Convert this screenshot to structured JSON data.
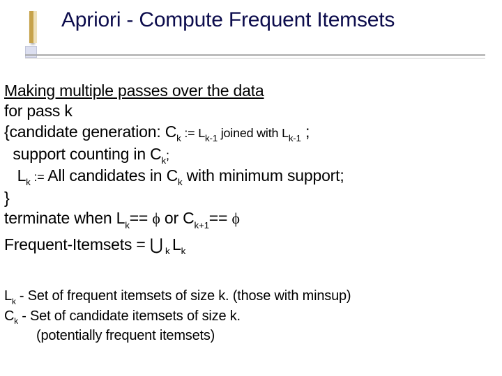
{
  "title": "Apriori - Compute Frequent Itemsets",
  "body": {
    "heading": "Making multiple passes over the data",
    "line_for": "for pass k",
    "cg_open": "{candidate generation: C",
    "cg_k": "k",
    "cg_assign": " := ",
    "cg_L": "L",
    "cg_km1_a": "k-1",
    "cg_join": " joined with ",
    "cg_L2": "L",
    "cg_km1_b": "k-1",
    "cg_semi": " ;",
    "supp_pre": "  support counting in C",
    "supp_k": "k",
    "supp_end": ";",
    "Lk_pre": "   L",
    "Lk_k": "k",
    "Lk_assign": " := ",
    "Lk_text": "All candidates in C",
    "Lk_ck": "k",
    "Lk_tail": " with minimum support;",
    "brace_close": "}",
    "term_pre": "terminate when L",
    "term_k": "k",
    "term_eq1": "== ",
    "term_phi1": "ϕ",
    "term_or": " or C",
    "term_kp1": "k+1",
    "term_eq2": "== ",
    "term_phi2": "ϕ",
    "freq_pre": "Frequent-Itemsets = ",
    "freq_union": "⋃",
    "freq_sub": " k ",
    "freq_L": "L",
    "freq_k": "k"
  },
  "notes": {
    "n1_pre": "L",
    "n1_k": "k",
    "n1_text": " - Set of frequent itemsets of size k. (those with minsup)",
    "n2_pre": "C",
    "n2_k": "k",
    "n2_text": " - Set of candidate itemsets of size k.",
    "n3_text": "(potentially frequent itemsets)"
  }
}
